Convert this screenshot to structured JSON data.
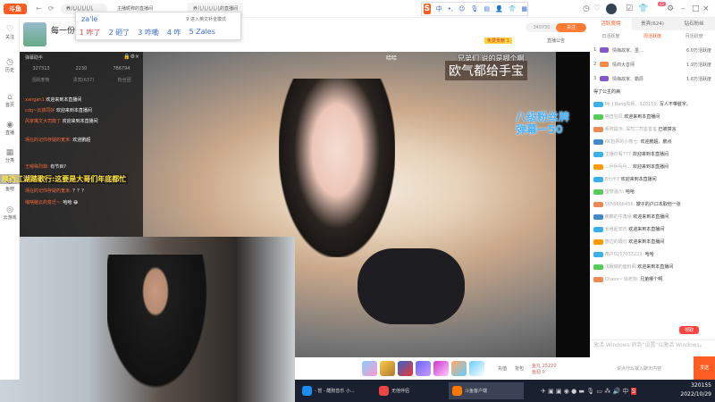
{
  "app": {
    "logo": "斗鱼",
    "back": "←",
    "refresh": "⟳"
  },
  "tabs": {
    "search_value": "养儿儿儿儿儿",
    "tab1": "主播昵称的直播间",
    "tab2": "养儿儿儿儿儿的直播间"
  },
  "ime": {
    "input": "za'le",
    "hint": "9 进入英文补全模式",
    "candidates": [
      "1 咋了",
      "2 砸了",
      "3 咋嘞",
      "4 咋",
      "5 Zales"
    ]
  },
  "sogou": {
    "lang": "中",
    "punct": "•,"
  },
  "window_controls": {
    "min": "–",
    "max": "□",
    "close": "×",
    "notif_count": "42"
  },
  "sidebar": [
    {
      "icon": "♡",
      "label": "关注"
    },
    {
      "icon": "◷",
      "label": "历史"
    },
    {
      "icon": "⌂",
      "label": "首页"
    },
    {
      "icon": "◉",
      "label": "直播"
    },
    {
      "icon": "▦",
      "label": "分类"
    },
    {
      "icon": "☺",
      "label": "鱼吧"
    },
    {
      "icon": "◎",
      "label": "云游戏"
    }
  ],
  "header": {
    "title": "每一份礼",
    "follower_count": "340730",
    "follow_label": "关注",
    "notice": "直播公告",
    "rank_badge": "免费贡献 1"
  },
  "video": {
    "top_caption": "兄弟们 说的是哪个啊",
    "banner": "欧气都给手宝",
    "fan_badge_line1": "八级粉丝牌",
    "fan_badge_line2": "弹幕一50",
    "corner": "哈哈"
  },
  "chat_window": {
    "title": "弹幕助手",
    "stats": [
      "327313",
      "2230",
      "786794"
    ],
    "tabs": [
      "活跃度榜",
      "贵宾(637)",
      "粉丝团"
    ],
    "messages": [
      {
        "user": "xangan1",
        "text": "欢迎来到本直播间"
      },
      {
        "user": "cdg~云孩同好",
        "text": "欢迎来到本直播间"
      },
      {
        "user": "风家嘴文大司篇了",
        "text": "欢迎来到本直播间"
      },
      {
        "user": "炳在的记你存疑的宽米:",
        "text": "欢迎鹏超"
      },
      {
        "user": "王嗯殊烈菲:",
        "text": "有节目?"
      },
      {
        "user": "炳在的记你存疑的宽米:",
        "text": "？？？"
      },
      {
        "user": "缩啥脑云的变迁~:",
        "text": "哈哈 😀"
      }
    ]
  },
  "scroll_text": "陕西江湖踏歌行:这要是大哥们年底都忙",
  "gifts": {
    "items": 7,
    "labels": [
      "充值",
      "背包"
    ],
    "fish_ball_label": "鱼丸",
    "fish_ball": "25220",
    "fish_wing_label": "鱼翅",
    "fish_wing": "0"
  },
  "right_panel": {
    "tabs": [
      "活跃度榜",
      "贵宾(624)",
      "钻石粉丝"
    ],
    "subtabs": [
      "日活跃度",
      "周活跃度",
      "月活跃度"
    ],
    "ranks": [
      {
        "n": "1",
        "name": "情梅故家、虽...",
        "score": "6.0万活跃度"
      },
      {
        "n": "2",
        "name": "情商大善师",
        "score": "1.9万活跃度"
      },
      {
        "n": "3",
        "name": "情梅故家、霸辰",
        "score": "1.6万活跃度"
      }
    ],
    "messages": [
      {
        "user": "",
        "text": "得了公主的病"
      },
      {
        "user": "Mr J Bang先师、320155:",
        "text": "写人不带脏字。"
      },
      {
        "user": "喵击狂风",
        "text": "欢迎来到本直播间"
      },
      {
        "user": "系统提示: 深司二司善善善",
        "text": "已被禁言"
      },
      {
        "user": "KK包弄的小熊七:",
        "text": "欢迎鹏超，鹏点"
      },
      {
        "user": "主播你看777",
        "text": "欢迎来到本直播间"
      },
      {
        "user": "...乒乒乓乓...",
        "text": "欢迎来到本直播间"
      },
      {
        "user": "8七示7",
        "text": "欢迎来到本直播间"
      },
      {
        "user": "望穿温沙:",
        "text": "哈哈"
      },
      {
        "user": "5656666456:",
        "text": "嫂子的户口本取他一张"
      },
      {
        "user": "鹏鹏的牛角组",
        "text": "欢迎来到本直播间"
      },
      {
        "user": "长组起安氏",
        "text": "欢迎来到本直播间"
      },
      {
        "user": "憋边的跟灯",
        "text": "欢迎来到本直播间"
      },
      {
        "user": "用户0237033223:",
        "text": "哈哈"
      },
      {
        "user": "浅眠做的面料阁",
        "text": "欢迎来到本直播间"
      },
      {
        "user": "Chaos~ 徐老狗:",
        "text": "兄弟哪个啊"
      }
    ],
    "claim": "领取",
    "input_placeholder": "说点什么输入聊天内容",
    "send": "发送",
    "watermark": "激活 Windows 转到\"设置\"以激活 Windows。"
  },
  "taskbar": {
    "items": [
      "- 暂 - 酷狗音乐 小...",
      "无他伴侣",
      "斗鱼客户端"
    ],
    "tray_lang": "中",
    "time": "320155",
    "date": "2022/10/29"
  }
}
